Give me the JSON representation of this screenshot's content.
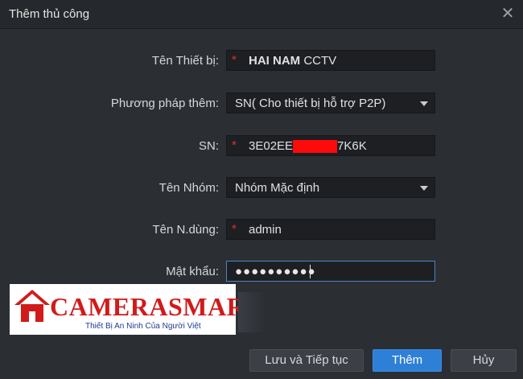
{
  "dialog": {
    "title": "Thêm thủ công",
    "close_icon": "close-icon"
  },
  "form": {
    "device_name": {
      "label": "Tên Thiết bị:",
      "required": "*",
      "value_bold": "HAI NAM",
      "value_rest": " CCTV"
    },
    "add_method": {
      "label": "Phương pháp thêm:",
      "value": "SN( Cho thiết bị hỗ trợ P2P)"
    },
    "sn": {
      "label": "SN:",
      "required": "*",
      "value_prefix": "3E02EE",
      "value_suffix": "7K6K"
    },
    "group": {
      "label": "Tên Nhóm:",
      "value": "Nhóm Mặc định"
    },
    "username": {
      "label": "Tên N.dùng:",
      "required": "*",
      "value": "admin"
    },
    "password": {
      "label": "Mật khẩu:",
      "value_masked": "●●●●●●●●●●"
    }
  },
  "watermark": {
    "brand": "CAMERASMART",
    "tagline": "Thiết Bị An Ninh Của Người Việt",
    "colors": {
      "brand": "#d11b1b",
      "tagline": "#1e3c8c"
    }
  },
  "buttons": {
    "save_continue": "Lưu và Tiếp tục",
    "add": "Thêm",
    "cancel": "Hủy"
  },
  "colors": {
    "background": "#2b2e33",
    "field": "#1d1f23",
    "primary": "#2e7fd6",
    "required": "#e03030"
  }
}
